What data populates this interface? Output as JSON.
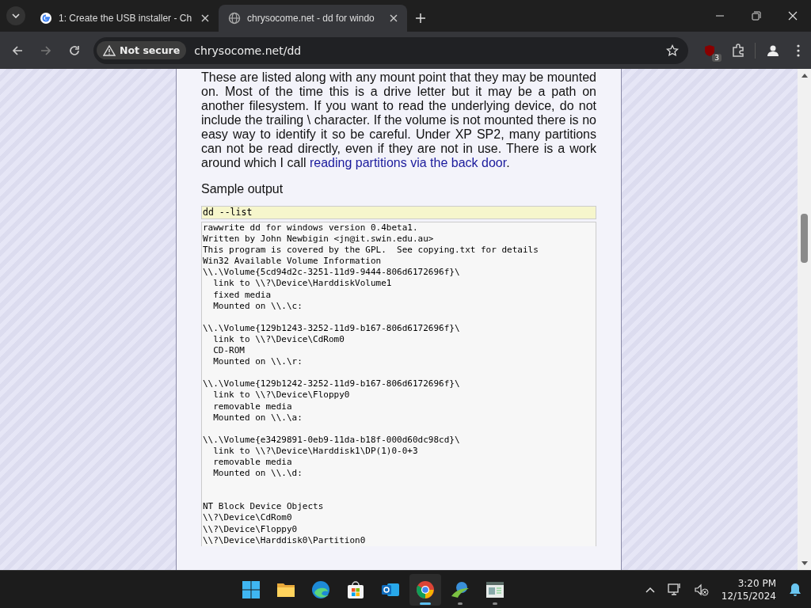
{
  "tabs": [
    {
      "title": "1: Create the USB installer - Ch",
      "kind": "google",
      "selected": false
    },
    {
      "title": "chrysocome.net - dd for windo",
      "kind": "globe",
      "selected": true
    }
  ],
  "toolbar": {
    "security": "Not secure",
    "url": "chrysocome.net/dd",
    "extension_badge": "3"
  },
  "article": {
    "paragraph": {
      "text": "These are listed along with any mount point that they may be mounted on. Most of the time this is a drive letter but it may be a path on another filesystem. If you want to read the underlying device, do not include the trailing \\ character. If the volume is not mounted there is no easy way to identify it so be careful. Under XP SP2, many partitions can not be read directly, even if they are not in use. There is a work around which I call ",
      "link": "reading partitions via the back door",
      "text_after": "."
    },
    "heading": "Sample output",
    "command": "dd --list",
    "output": "rawwrite dd for windows version 0.4beta1.\nWritten by John Newbigin <jn@it.swin.edu.au>\nThis program is covered by the GPL.  See copying.txt for details\nWin32 Available Volume Information\n\\\\.\\Volume{5cd94d2c-3251-11d9-9444-806d6172696f}\\\n  link to \\\\?\\Device\\HarddiskVolume1\n  fixed media\n  Mounted on \\\\.\\c:\n\n\\\\.\\Volume{129b1243-3252-11d9-b167-806d6172696f}\\\n  link to \\\\?\\Device\\CdRom0\n  CD-ROM\n  Mounted on \\\\.\\r:\n\n\\\\.\\Volume{129b1242-3252-11d9-b167-806d6172696f}\\\n  link to \\\\?\\Device\\Floppy0\n  removable media\n  Mounted on \\\\.\\a:\n\n\\\\.\\Volume{e3429891-0eb9-11da-b18f-000d60dc98cd}\\\n  link to \\\\?\\Device\\Harddisk1\\DP(1)0-0+3\n  removable media\n  Mounted on \\\\.\\d:\n\n\nNT Block Device Objects\n\\\\?\\Device\\CdRom0\n\\\\?\\Device\\Floppy0\n\\\\?\\Device\\Harddisk0\\Partition0"
  },
  "taskbar": {
    "apps": [
      {
        "kind": "start",
        "running": false,
        "selected": false
      },
      {
        "kind": "folder",
        "running": false,
        "selected": false
      },
      {
        "kind": "edge",
        "running": false,
        "selected": false
      },
      {
        "kind": "store",
        "running": false,
        "selected": false
      },
      {
        "kind": "mail",
        "running": false,
        "selected": false
      },
      {
        "kind": "chrome",
        "running": true,
        "selected": true
      },
      {
        "kind": "download",
        "running": true,
        "selected": false
      },
      {
        "kind": "window",
        "running": true,
        "selected": false
      }
    ],
    "time": "3:20 PM",
    "date": "12/15/2024"
  }
}
